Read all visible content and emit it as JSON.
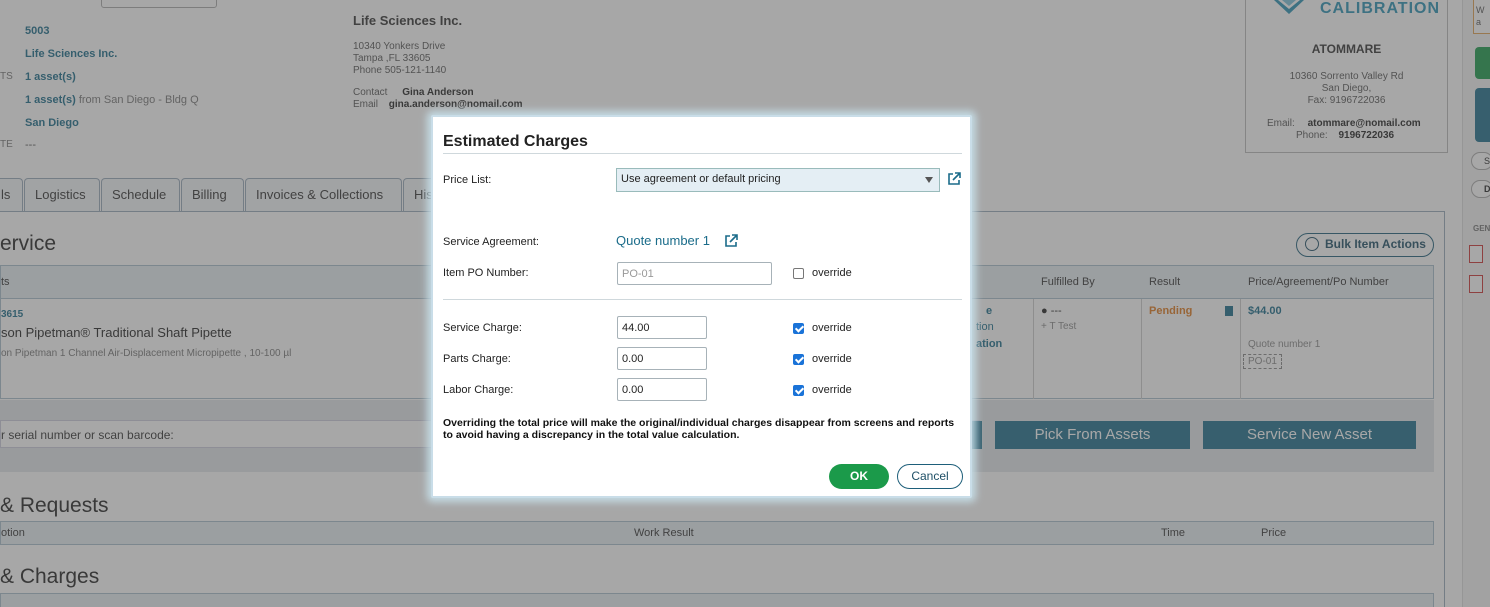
{
  "customer": {
    "id": "5003",
    "name": "Life Sciences Inc.",
    "assets": "1 asset(s)",
    "assets_from_num": "1 asset(s)",
    "assets_from_loc": "from San Diego - Bldg Q",
    "location": "San Diego",
    "blank": "---",
    "stub_ts": "TS",
    "stub_te": "TE"
  },
  "billing_address": {
    "title": "Life Sciences Inc.",
    "line1": "10340 Yonkers Drive",
    "line2": "Tampa ,FL 33605",
    "phone": "Phone 505-121-1140",
    "contact_label": "Contact",
    "contact_name": "Gina Anderson",
    "email_label": "Email",
    "email": "gina.anderson@nomail.com"
  },
  "vendor": {
    "logo_text": "CALIBRATION",
    "name": "ATOMMARE",
    "line1": "10360 Sorrento Valley Rd",
    "line2": "San Diego,",
    "fax": "Fax: 9196722036",
    "email_label": "Email:",
    "email": "atommare@nomail.com",
    "phone_label": "Phone:",
    "phone": "9196722036"
  },
  "tabs": [
    {
      "label": "ls"
    },
    {
      "label": "Logistics"
    },
    {
      "label": "Schedule"
    },
    {
      "label": "Billing"
    },
    {
      "label": "Invoices & Collections"
    },
    {
      "label": "His"
    }
  ],
  "service_section": {
    "title": "ervice",
    "bulk_label": "Bulk Item Actions",
    "headers": {
      "col1": "ts",
      "fulfilled": "Fulfilled By",
      "result": "Result",
      "price": "Price/Agreement/Po Number"
    },
    "row": {
      "id": "3615",
      "name": "son Pipetman® Traditional Shaft Pipette",
      "desc": "on Pipetman 1 Channel Air-Displacement Micropipette , 10-100 µl",
      "fulfilled": "---",
      "fulfilled_sub": "+ T Test",
      "result": "Pending",
      "price": "$44.00",
      "agreement": "Quote number 1",
      "po": "PO-01",
      "partial_1": "e",
      "partial_2": "tion",
      "partial_3": "ation"
    },
    "scan_label": "r serial number or scan barcode:",
    "pick_label": "Pick From Assets",
    "new_asset_label": "Service New Asset"
  },
  "requests_section": {
    "title": "& Requests",
    "headers": {
      "c1": "otion",
      "c2": "Work Result",
      "c3": "Time",
      "c4": "Price"
    }
  },
  "charges_section": {
    "title": "& Charges"
  },
  "side": {
    "s1": "W",
    "s2": "a",
    "s3": "S",
    "s4": "D",
    "s5": "GEN"
  },
  "modal": {
    "title": "Estimated Charges",
    "price_list_label": "Price List:",
    "price_list_value": "Use agreement or default pricing",
    "agreement_label": "Service Agreement:",
    "agreement_value": "Quote number 1",
    "po_label": "Item PO Number:",
    "po_placeholder": "PO-01",
    "override_label": "override",
    "service_label": "Service Charge:",
    "service_value": "44.00",
    "parts_label": "Parts Charge:",
    "parts_value": "0.00",
    "labor_label": "Labor Charge:",
    "labor_value": "0.00",
    "note": "Overriding the total price will make the original/individual charges disappear from screens and reports to avoid having a discrepancy in the total value calculation.",
    "ok_label": "OK",
    "cancel_label": "Cancel"
  },
  "colors": {
    "accent": "#1e6f8c",
    "ok": "#1b9a4a",
    "checkbox": "#1a73d8",
    "pending": "#e07a1f"
  },
  "icons": [
    "external-link-icon",
    "chevron-down-icon",
    "user-icon",
    "document-icon",
    "pdf-icon"
  ]
}
